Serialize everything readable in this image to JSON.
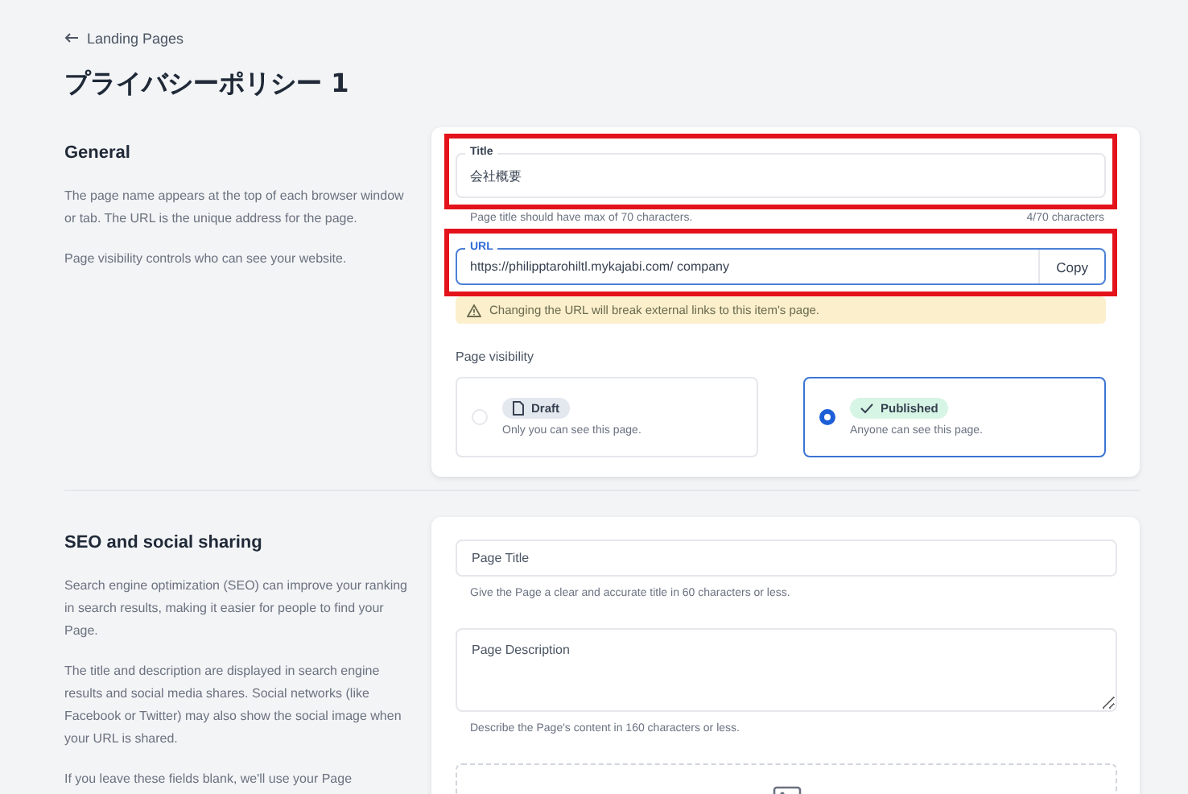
{
  "breadcrumb": {
    "label": "Landing Pages"
  },
  "page_title": "プライバシーポリシー 1",
  "general": {
    "heading": "General",
    "paragraphs": [
      "The page name appears at the top of each browser window or tab. The URL is the unique address for the page.",
      "Page visibility controls who can see your website."
    ],
    "title_field": {
      "label": "Title",
      "value": "会社概要",
      "highlighted": true,
      "hint": "Page title should have max of 70 characters.",
      "counter": "4/70 characters"
    },
    "url_field": {
      "label": "URL",
      "value": "https://philipptarohiltl.mykajabi.com/ company",
      "highlighted": true,
      "button": "Copy",
      "focused": true
    },
    "warning": "Changing the URL will break external links to this item's page.",
    "visibility": {
      "label": "Page visibility",
      "options": [
        {
          "kind": "draft",
          "badge": "Draft",
          "description": "Only you can see this page.",
          "selected": false
        },
        {
          "kind": "published",
          "badge": "Published",
          "description": "Anyone can see this page.",
          "selected": true
        }
      ]
    }
  },
  "seo": {
    "heading": "SEO and social sharing",
    "paragraphs": [
      "Search engine optimization (SEO) can improve your ranking in search results, making it easier for people to find your Page.",
      "The title and description are displayed in search engine results and social media shares. Social networks (like Facebook or Twitter) may also show the social image when your URL is shared.",
      "If you leave these fields blank, we'll use your Page"
    ],
    "title_field": {
      "placeholder": "Page Title",
      "hint": "Give the Page a clear and accurate title in 60 characters or less."
    },
    "description_field": {
      "placeholder": "Page Description",
      "hint": "Describe the Page's content in 160 characters or less."
    }
  }
}
